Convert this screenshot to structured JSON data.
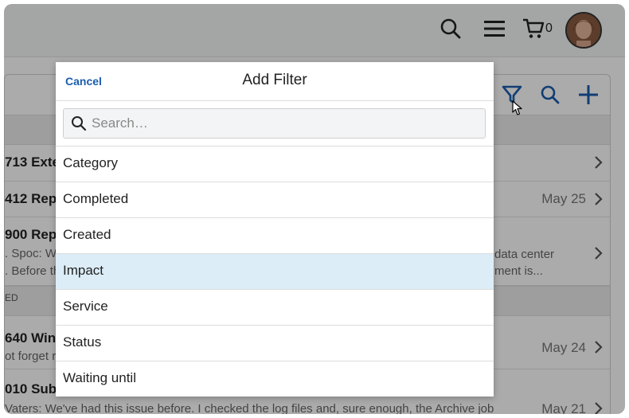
{
  "topbar": {
    "cart_count": "0"
  },
  "list": {
    "rows": [
      {
        "title": "713  Exte",
        "desc": "",
        "right": "",
        "date": ""
      },
      {
        "title": "412  Rep",
        "desc": "",
        "right": "",
        "date": "May 25"
      },
      {
        "title": "900  Rep",
        "desc": ". Spoc: W",
        "desc2": ". Before th",
        "right": "data center",
        "right2": "ment is...",
        "date": ""
      },
      {
        "title": "640  Win",
        "desc": "ot forget r",
        "right": "",
        "date": "May 24"
      },
      {
        "title": "010  Sub",
        "desc": "Vaters: We've had this issue before. I checked the log files and, sure enough, the Archive job",
        "right": "",
        "date": "May 21"
      }
    ],
    "band_label": "ED"
  },
  "modal": {
    "cancel_label": "Cancel",
    "title": "Add Filter",
    "search_placeholder": "Search…",
    "options": [
      "Category",
      "Completed",
      "Created",
      "Impact",
      "Service",
      "Status",
      "Waiting until"
    ],
    "selected": "Impact"
  },
  "colors": {
    "accent": "#1a5dad",
    "selected_row": "#dcedf8"
  }
}
